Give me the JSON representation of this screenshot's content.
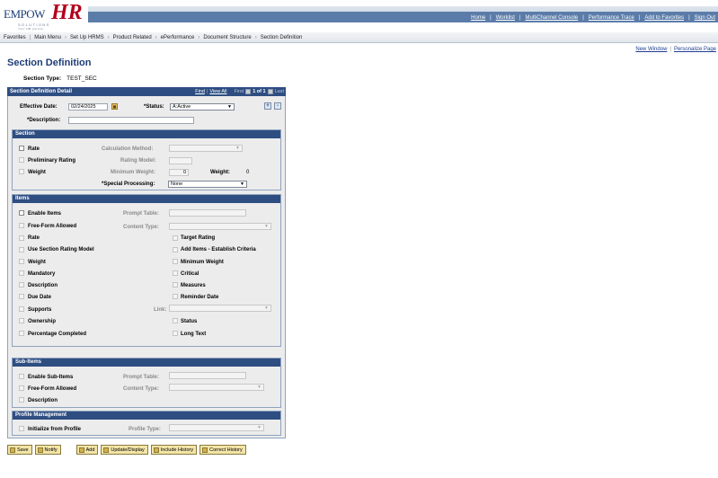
{
  "logo": {
    "brand_left": "EMPOW",
    "brand_right": "HR",
    "tagline": "SOLUTIONS",
    "sub_tagline": "Your HR partner"
  },
  "nav_links": [
    "Home",
    "Worklist",
    "MultiChannel Console",
    "Performance Trace",
    "Add to Favorites",
    "Sign Out"
  ],
  "breadcrumb": [
    "Favorites",
    "Main Menu",
    "Set Up HRMS",
    "Product Related",
    "ePerformance",
    "Document Structure",
    "Section Definition"
  ],
  "top_links": [
    "New Window",
    "Personalize Page"
  ],
  "page_title": "Section Definition",
  "section_type": {
    "label": "Section Type:",
    "value": "TEST_SEC"
  },
  "detail": {
    "header": "Section Definition Detail",
    "find": "Find",
    "view_all": "View All",
    "first": "First",
    "counter": "1 of 1",
    "last": "Last",
    "effective_date_label": "Effective Date:",
    "effective_date_value": "02/24/2025",
    "status_label": "*Status:",
    "status_value": "A:Active",
    "description_label": "*Description:",
    "description_value": "",
    "add_row": "+",
    "delete_row": "-"
  },
  "section": {
    "header": "Section",
    "rate": "Rate",
    "preliminary_rating": "Preliminary Rating",
    "weight": "Weight",
    "calc_method": "Calculation Method:",
    "rating_model": "Rating Model:",
    "min_weight": "Minimum Weight:",
    "min_weight_value": "0",
    "weight_label": "Weight:",
    "weight_value": "0",
    "special_processing": "*Special Processing:",
    "special_processing_value": "None"
  },
  "items": {
    "header": "Items",
    "enable_items": "Enable Items",
    "prompt_table": "Prompt Table:",
    "free_form": "Free-Form Allowed",
    "content_type": "Content Type:",
    "left": [
      "Rate",
      "Use Section Rating Model",
      "Weight",
      "Mandatory",
      "Description",
      "Due Date",
      "Supports",
      "Ownership",
      "Percentage Completed"
    ],
    "right": [
      "Target Rating",
      "Add Items - Establish Criteria",
      "Minimum Weight",
      "Critical",
      "Measures",
      "Reminder Date",
      "",
      "Status",
      "Long Text"
    ],
    "link_label": "Link:"
  },
  "sub_items": {
    "header": "Sub-Items",
    "enable": "Enable Sub-Items",
    "prompt_table": "Prompt Table:",
    "free_form": "Free-Form Allowed",
    "content_type": "Content Type:",
    "description": "Description"
  },
  "profile": {
    "header": "Profile Management",
    "init": "Initialize from Profile",
    "profile_type": "Profile Type:"
  },
  "buttons": [
    "Save",
    "Notify",
    "Add",
    "Update/Display",
    "Include History",
    "Correct History"
  ]
}
